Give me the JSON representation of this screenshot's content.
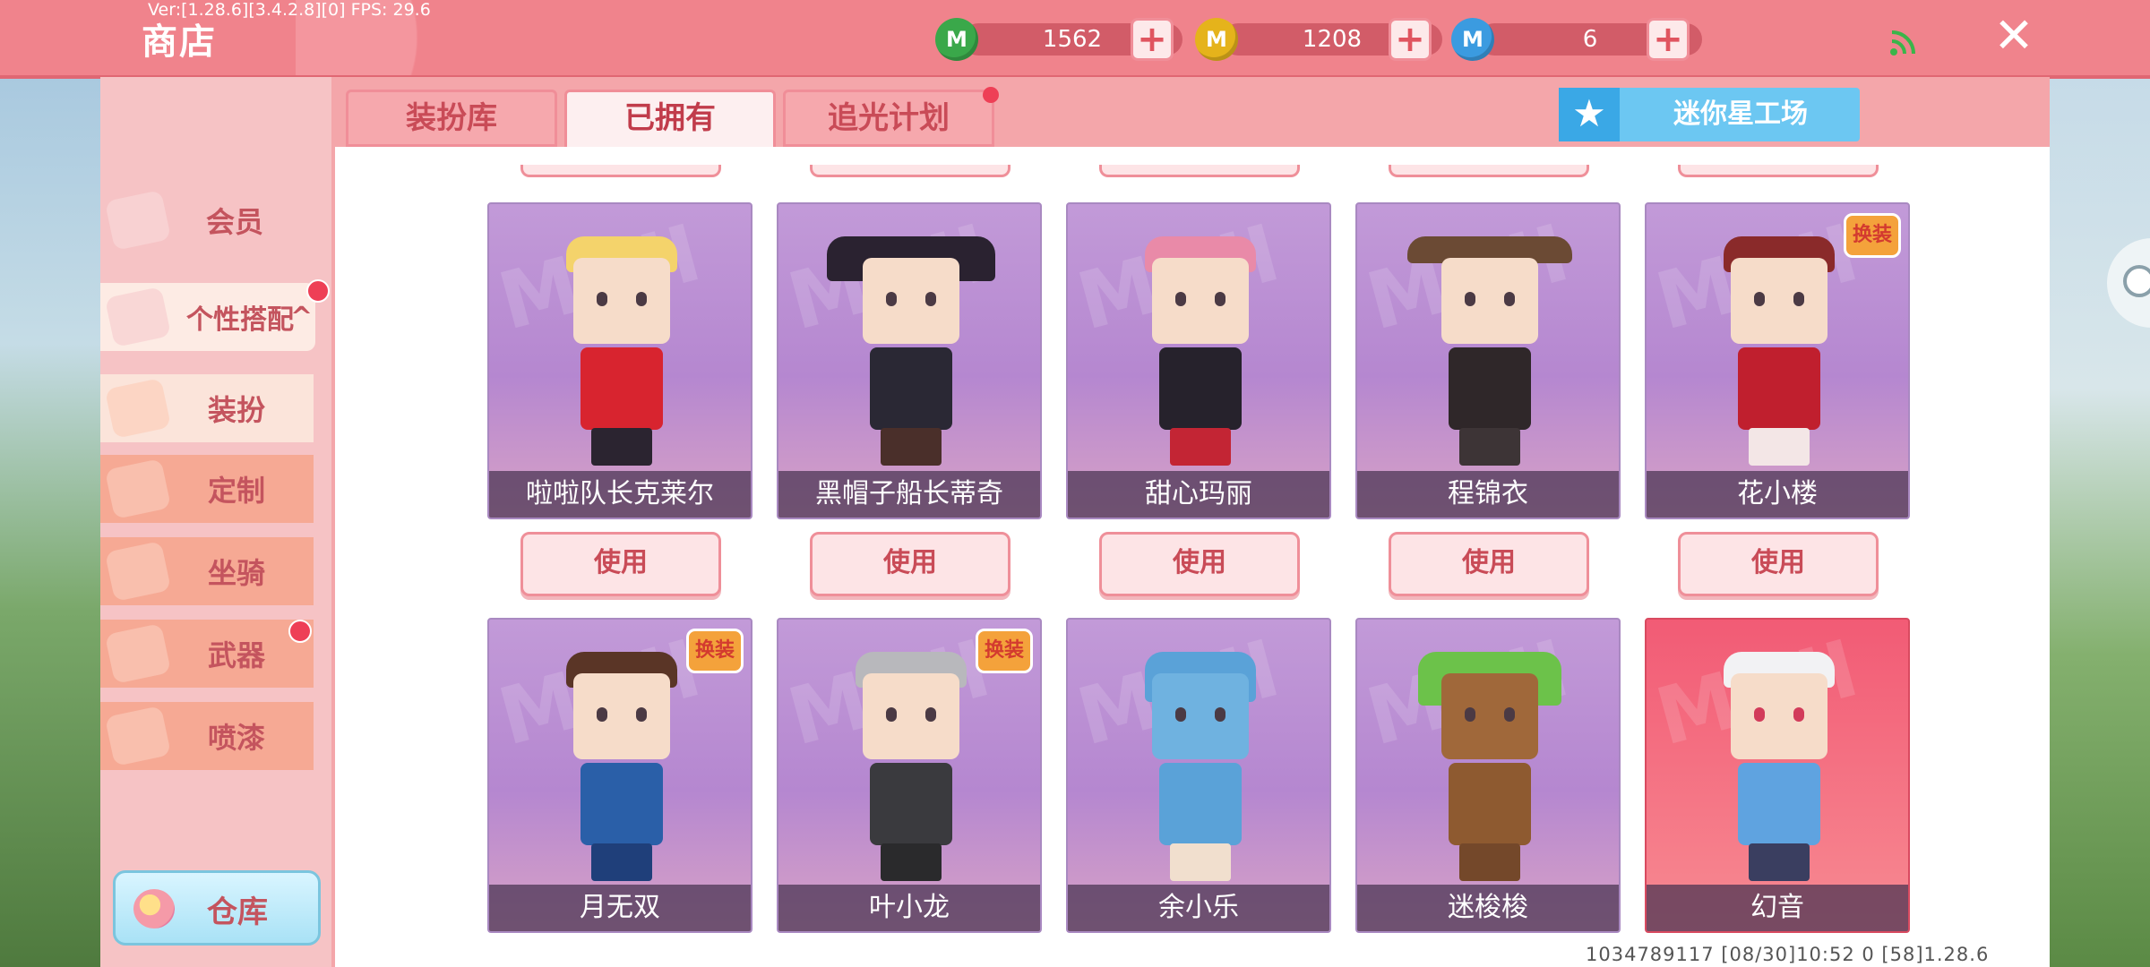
{
  "top_bar": {
    "version": "Ver:[1.28.6][3.4.2.8][0] FPS: 29.6",
    "title": "商店",
    "currencies": [
      {
        "icon": "mini-bean-green-icon",
        "value": "1562",
        "color": "#3aa84a"
      },
      {
        "icon": "mini-coin-gold-icon",
        "value": "1208",
        "color": "#e5b31b"
      },
      {
        "icon": "mini-point-blue-icon",
        "value": "6",
        "color": "#3b9be0"
      }
    ],
    "plus_label": "+",
    "wifi_icon": "signal-icon",
    "close_label": "✕"
  },
  "sidebar": {
    "items": [
      {
        "label": "会员",
        "icon": "vip-icon"
      },
      {
        "label": "个性搭配",
        "icon": "outfit-icon",
        "expanded": true,
        "indicator": "^"
      },
      {
        "label": "装扮",
        "icon": "skin-icon",
        "selected": true
      },
      {
        "label": "定制",
        "icon": "custom-icon"
      },
      {
        "label": "坐骑",
        "icon": "mount-icon"
      },
      {
        "label": "武器",
        "icon": "weapon-icon"
      },
      {
        "label": "喷漆",
        "icon": "spray-icon"
      }
    ],
    "warehouse_label": "仓库"
  },
  "tabs": [
    {
      "label": "装扮库",
      "active": false
    },
    {
      "label": "已拥有",
      "active": true
    },
    {
      "label": "追光计划",
      "active": false,
      "notify": true
    }
  ],
  "workshop_button": {
    "label": "迷你星工场",
    "icon": "star-icon"
  },
  "watermark": "MINI",
  "items_row1": [
    {
      "name": "啦啦队长克莱尔"
    },
    {
      "name": "黑帽子船长蒂奇"
    },
    {
      "name": "甜心玛丽"
    },
    {
      "name": "程锦衣"
    },
    {
      "name": "花小楼",
      "badge": "换装"
    }
  ],
  "items_row2": [
    {
      "name": "月无双",
      "badge": "换装"
    },
    {
      "name": "叶小龙",
      "badge": "换装"
    },
    {
      "name": "余小乐"
    },
    {
      "name": "迷梭梭"
    },
    {
      "name": "幻音"
    }
  ],
  "use_label": "使用",
  "footer": "1034789117   [08/30]10:52 0 [58]1.28.6",
  "colors": {
    "topbar": "#f0838c",
    "accent": "#c94b57",
    "card": "#b587d0",
    "badge": "#f4a23b"
  }
}
